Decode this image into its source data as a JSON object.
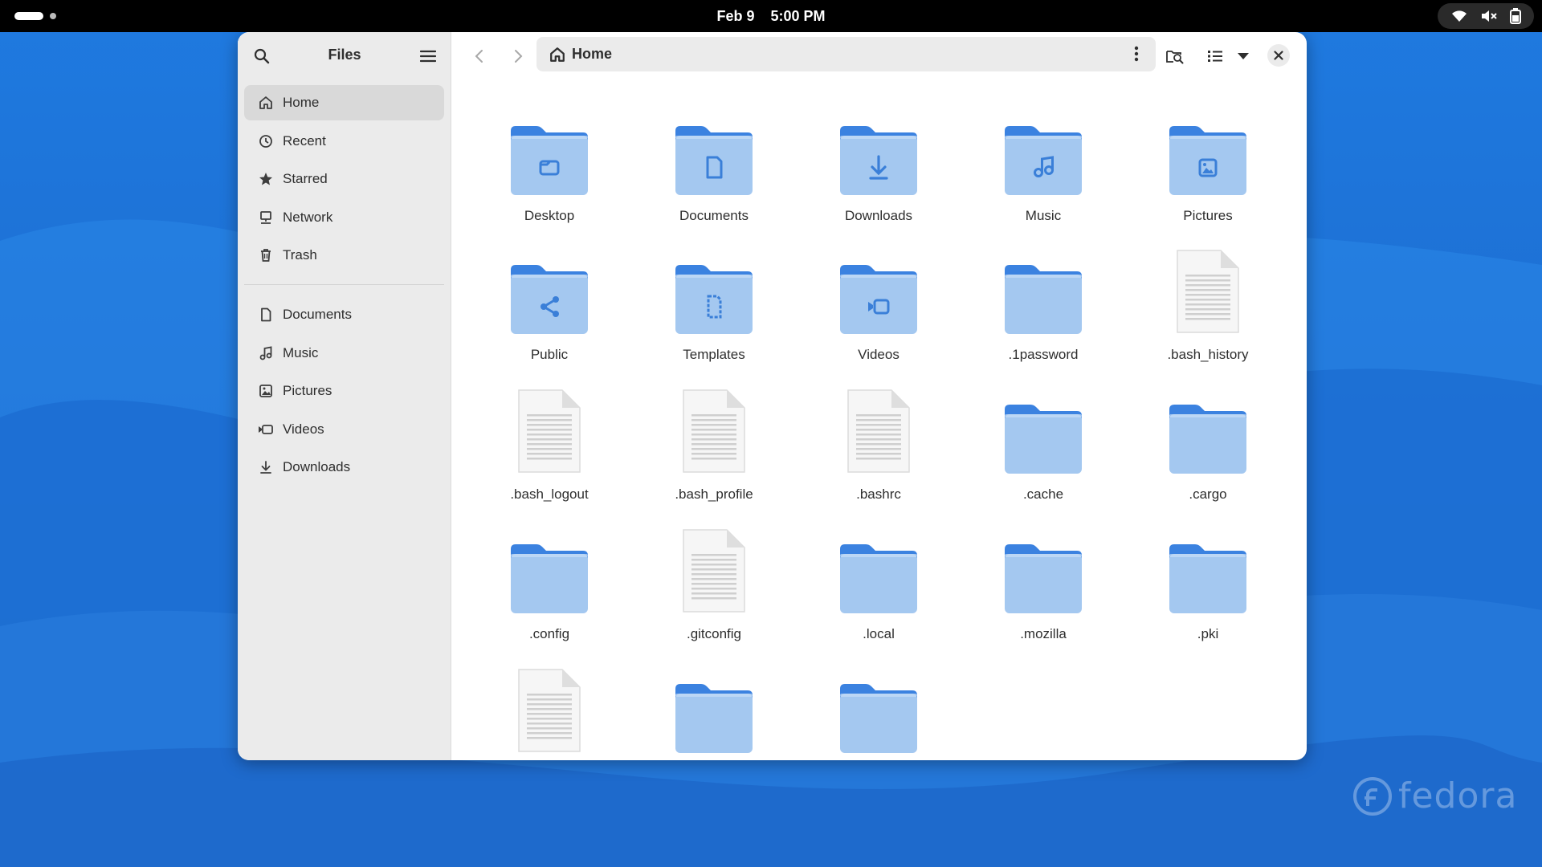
{
  "topbar": {
    "date": "Feb 9",
    "time": "5:00 PM",
    "tray_icons": [
      "wifi-icon",
      "volume-muted-icon",
      "battery-icon"
    ]
  },
  "watermark": {
    "text": "fedora"
  },
  "colors": {
    "folder_back": "#3b82e0",
    "folder_front": "#a4c8f0",
    "folder_glyph": "#3a7fd8",
    "sidebar_bg": "#ebebeb",
    "sidebar_active": "#d9d9d9",
    "text": "#2e2e2e"
  },
  "sidebar": {
    "title": "Files",
    "places": [
      {
        "label": "Home",
        "icon": "home-icon",
        "active": true
      },
      {
        "label": "Recent",
        "icon": "clock-icon"
      },
      {
        "label": "Starred",
        "icon": "star-icon"
      },
      {
        "label": "Network",
        "icon": "network-icon"
      },
      {
        "label": "Trash",
        "icon": "trash-icon"
      }
    ],
    "bookmarks": [
      {
        "label": "Documents",
        "icon": "document-icon"
      },
      {
        "label": "Music",
        "icon": "music-icon"
      },
      {
        "label": "Pictures",
        "icon": "picture-icon"
      },
      {
        "label": "Videos",
        "icon": "video-icon"
      },
      {
        "label": "Downloads",
        "icon": "download-icon"
      }
    ]
  },
  "toolbar": {
    "path_label": "Home"
  },
  "files": [
    {
      "name": "Desktop",
      "type": "folder",
      "glyph": "desktop"
    },
    {
      "name": "Documents",
      "type": "folder",
      "glyph": "document"
    },
    {
      "name": "Downloads",
      "type": "folder",
      "glyph": "download"
    },
    {
      "name": "Music",
      "type": "folder",
      "glyph": "music"
    },
    {
      "name": "Pictures",
      "type": "folder",
      "glyph": "picture"
    },
    {
      "name": "Public",
      "type": "folder",
      "glyph": "share"
    },
    {
      "name": "Templates",
      "type": "folder",
      "glyph": "template"
    },
    {
      "name": "Videos",
      "type": "folder",
      "glyph": "video"
    },
    {
      "name": ".1password",
      "type": "folder",
      "glyph": ""
    },
    {
      "name": ".bash_history",
      "type": "file",
      "glyph": ""
    },
    {
      "name": ".bash_logout",
      "type": "file",
      "glyph": ""
    },
    {
      "name": ".bash_profile",
      "type": "file",
      "glyph": ""
    },
    {
      "name": ".bashrc",
      "type": "file",
      "glyph": ""
    },
    {
      "name": ".cache",
      "type": "folder",
      "glyph": ""
    },
    {
      "name": ".cargo",
      "type": "folder",
      "glyph": ""
    },
    {
      "name": ".config",
      "type": "folder",
      "glyph": ""
    },
    {
      "name": ".gitconfig",
      "type": "file",
      "glyph": ""
    },
    {
      "name": ".local",
      "type": "folder",
      "glyph": ""
    },
    {
      "name": ".mozilla",
      "type": "folder",
      "glyph": ""
    },
    {
      "name": ".pki",
      "type": "folder",
      "glyph": ""
    },
    {
      "name": "",
      "type": "file",
      "glyph": ""
    },
    {
      "name": "",
      "type": "folder",
      "glyph": ""
    },
    {
      "name": "",
      "type": "folder",
      "glyph": ""
    }
  ]
}
